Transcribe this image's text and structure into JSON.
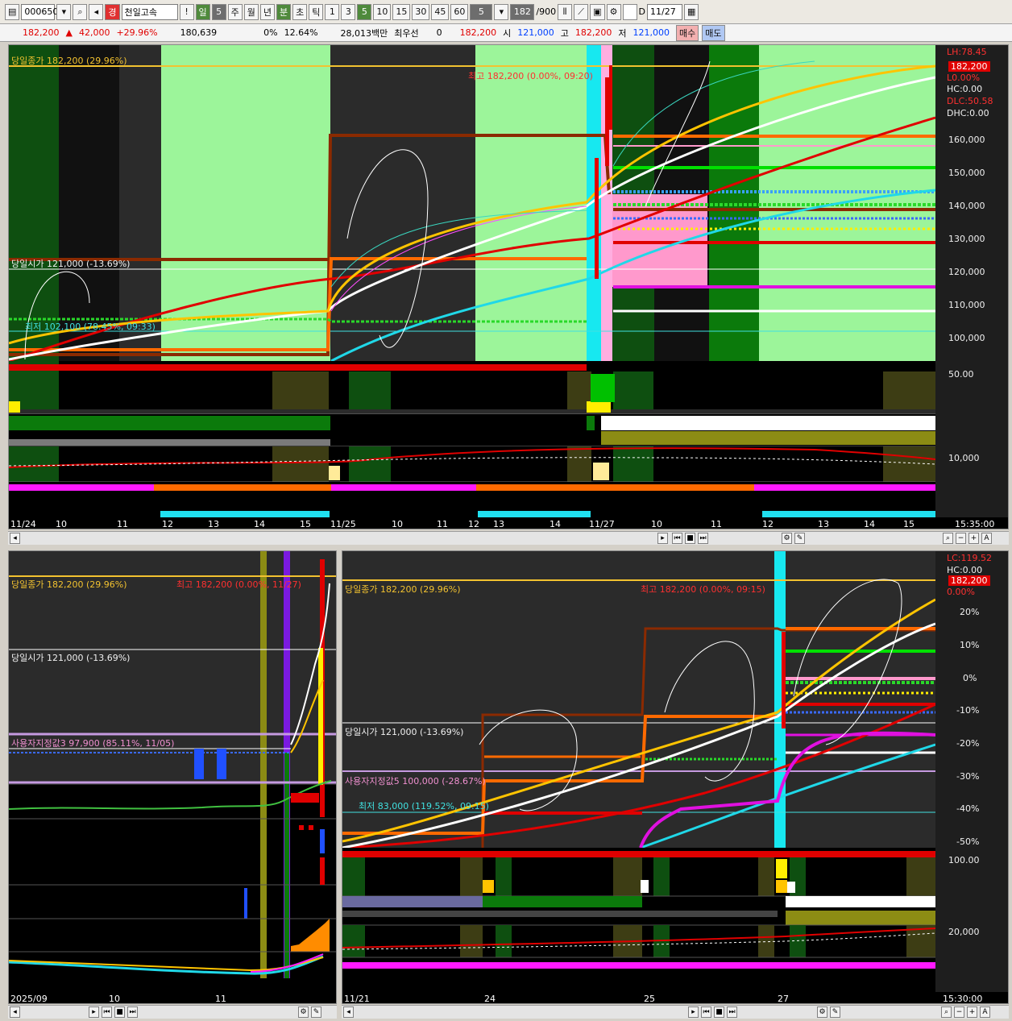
{
  "toolbar": {
    "code": "000650",
    "name": "천일고속",
    "grade": "경",
    "alert": "!",
    "period_day": "일",
    "day_num": "5",
    "week": "주",
    "month": "월",
    "year": "년",
    "minute": "분",
    "second": "초",
    "tick": "틱",
    "intervals": [
      "1",
      "3",
      "5",
      "10",
      "15",
      "30",
      "45",
      "60"
    ],
    "interval_sel": "5",
    "count": "182",
    "count_max": "/900",
    "d_label": "D",
    "date": "11/27"
  },
  "quote": {
    "price": "182,200",
    "change": "42,000",
    "pct": "+29.96%",
    "volume": "180,639",
    "ratio": "0%",
    "turnover": "12.64%",
    "amount": "28,013백만",
    "best": "최우선",
    "best_val": "0",
    "bid": "182,200",
    "open_label": "시",
    "open": "121,000",
    "high_label": "고",
    "high": "182,200",
    "low_label": "저",
    "low": "121,000",
    "buy": "매수",
    "sell": "매도"
  },
  "top": {
    "close_label": "당일종가 182,200 (29.96%)",
    "high_label": "최고 182,200 (0.00%, 09:20)",
    "open_label": "당일시가 121,000 (-13.69%)",
    "low_label": "최저 102,100 (78.45%, 09:33)",
    "right_info": [
      "LH:78.45",
      "L0.00%",
      "HC:0.00",
      "DLC:50.58",
      "DHC:0.00"
    ],
    "price_tag": "182,200",
    "yaxis": [
      "160,000",
      "150,000",
      "140,000",
      "130,000",
      "120,000",
      "110,000",
      "100,000"
    ],
    "sub1": "50.00",
    "sub3": "10,000",
    "xaxis": [
      "11/24",
      "10",
      "11",
      "12",
      "13",
      "14",
      "15",
      "11/25",
      "10",
      "11",
      "12",
      "13",
      "14",
      "11/27",
      "10",
      "11",
      "12",
      "13",
      "14",
      "15"
    ],
    "time": "15:35:00"
  },
  "left": {
    "close_label": "당일종가 182,200 (29.96%)",
    "high_label": "최고 182,200 (0.00%, 11/27)",
    "open_label": "당일시가 121,000 (-13.69%)",
    "support_label": "사용자지정값3 97,900 (85.11%, 11/05)",
    "xaxis": [
      "2025/09",
      "10",
      "11"
    ]
  },
  "right": {
    "close_label": "당일종가 182,200 (29.96%)",
    "high_label": "최고 182,200 (0.00%, 09:15)",
    "open_label": "당일시가 121,000 (-13.69%)",
    "support_label": "사용자지정값5 100,000 (-28.67%)",
    "low_label": "최저 83,000 (119.52%, 09:15)",
    "right_info": [
      "LC:119.52",
      "HC:0.00",
      "0.00%"
    ],
    "price_tag": "182,200",
    "yaxis": [
      "20%",
      "10%",
      "0%",
      "-10%",
      "-20%",
      "-30%",
      "-40%",
      "-50%"
    ],
    "sub1": "100.00",
    "sub3": "20,000",
    "xaxis": [
      "11/21",
      "24",
      "25",
      "27"
    ],
    "time": "15:30:00"
  }
}
